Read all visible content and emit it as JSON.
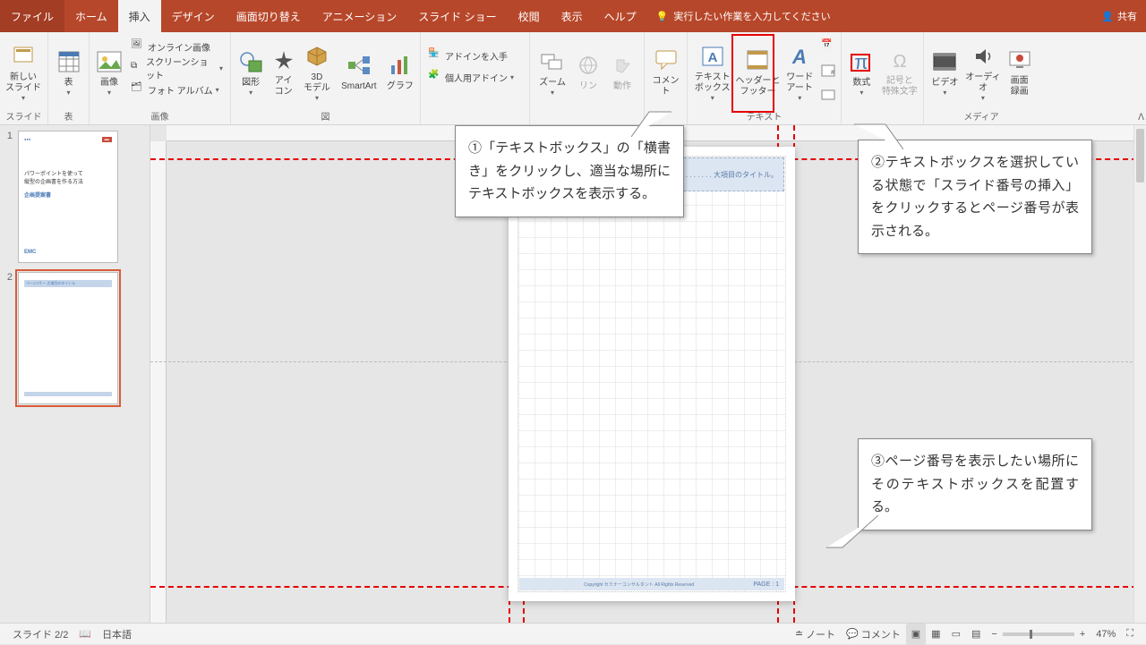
{
  "titlebar": {
    "tabs": {
      "file": "ファイル",
      "home": "ホーム",
      "insert": "挿入",
      "design": "デザイン",
      "transitions": "画面切り替え",
      "animations": "アニメーション",
      "slideshow": "スライド ショー",
      "review": "校閲",
      "view": "表示",
      "help": "ヘルプ"
    },
    "tellme": "実行したい作業を入力してください",
    "share": "共有"
  },
  "ribbon": {
    "groups": {
      "slides": "スライド",
      "tables": "表",
      "images": "画像",
      "illustrations": "図",
      "addins": "",
      "zoom": "",
      "comments": "",
      "text": "テキスト",
      "symbols": "",
      "media": "メディア"
    },
    "slides": {
      "new_slide": "新しい\nスライド"
    },
    "tables": {
      "table": "表"
    },
    "images": {
      "pictures": "画像",
      "online": "オンライン画像",
      "screenshot": "スクリーンショット",
      "album": "フォト アルバム"
    },
    "illustrations": {
      "shapes": "図形",
      "icons": "アイ\nコン",
      "models3d": "3D\nモデル",
      "smartart": "SmartArt",
      "chart": "グラフ"
    },
    "addins": {
      "get": "アドインを入手",
      "my": "個人用アドイン"
    },
    "zoom": {
      "zoom": "ズーム",
      "link": "リン",
      "action": "動作"
    },
    "comments": {
      "comment": "コメント"
    },
    "text": {
      "textbox": "テキスト\nボックス",
      "headerfooter": "ヘッダーと\nフッター",
      "wordart": "ワード\nアート"
    },
    "symbols": {
      "equation": "数式",
      "symbol": "記号と\n特殊文字"
    },
    "media": {
      "video": "ビデオ",
      "audio": "オーディオ",
      "screenrec": "画面\n録画"
    }
  },
  "slide": {
    "header_text": ". . . . . . . 大項目のタイトル。",
    "footer_page": "PAGE :  1",
    "footer_copy": "Copyright セミナーコンサルタント All Rights Reserved"
  },
  "callouts": {
    "c1": "①「テキストボックス」の「横書き」をクリックし、適当な場所にテキストボックスを表示する。",
    "c2": "②テキストボックスを選択している状態で「スライド番号の挿入」をクリックするとページ番号が表示される。",
    "c3": "③ページ番号を表示したい場所にそのテキストボックスを配置する。"
  },
  "thumbs": {
    "t1": {
      "line1": "パワーポイントを使って",
      "line2": "縦型の企画書を作る方法",
      "line3": "企画提案書",
      "logo": "EMC"
    },
    "t2": {
      "hdr": "ページ1サー 大項目のタイトル"
    }
  },
  "status": {
    "slide": "スライド 2/2",
    "lang": "日本語",
    "notes": "ノート",
    "comments": "コメント",
    "zoom": "47%"
  }
}
